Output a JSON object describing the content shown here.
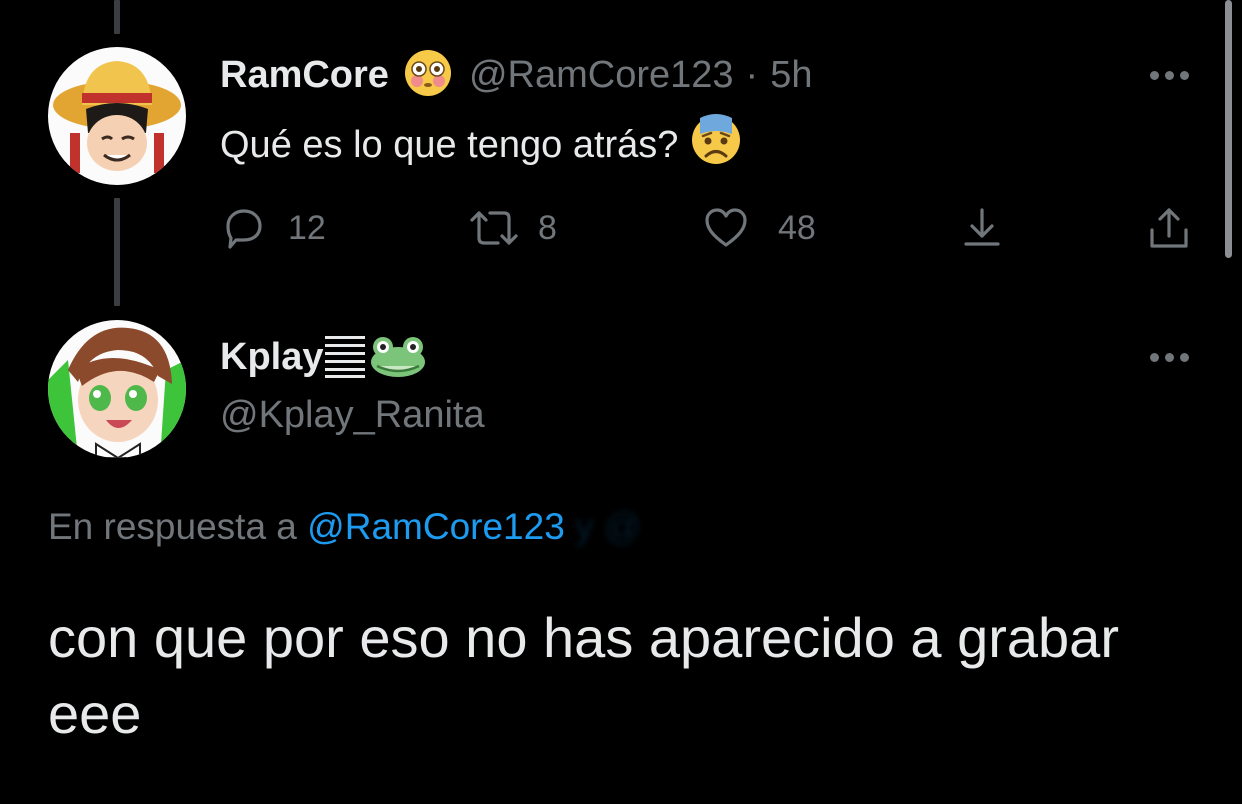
{
  "tweet": {
    "author_name": "RamCore",
    "author_handle": "@RamCore123",
    "separator": "·",
    "time": "5h",
    "text": "Qué es lo que tengo atrás?",
    "name_emoji": "flushed-face-emoji",
    "text_emoji": "anxious-face-emoji",
    "actions": {
      "replies": "12",
      "retweets": "8",
      "likes": "48"
    }
  },
  "reply": {
    "author_name": "Kplay",
    "author_handle": "@Kplay_Ranita",
    "name_emojis": [
      "lines-icon",
      "frog-face-emoji"
    ],
    "replying_prefix": "En respuesta a",
    "replying_mention": "@RamCore123",
    "replying_hidden": "y @",
    "text": "con que por eso no has aparecido a grabar eee"
  },
  "colors": {
    "background": "#000000",
    "text": "#e7e9ea",
    "muted": "#71767b",
    "accent": "#1d9bf0",
    "thread_line": "#3a3d41"
  }
}
